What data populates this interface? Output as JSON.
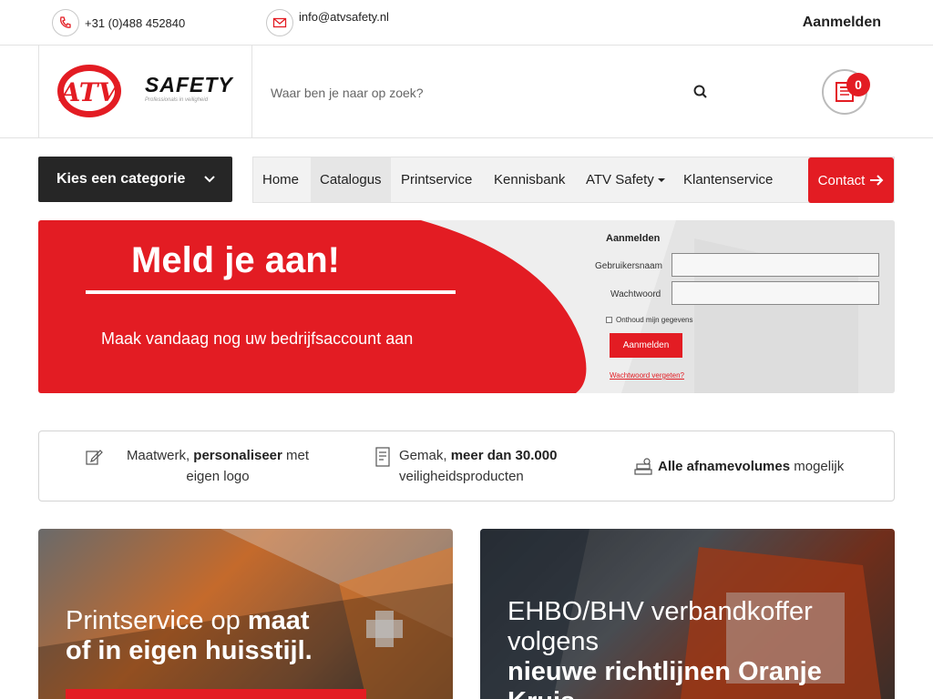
{
  "topbar": {
    "phone": "+31 (0)488 452840",
    "email": "info@atvsafety.nl",
    "login": "Aanmelden"
  },
  "header": {
    "logo_text": "SAFETY",
    "logo_tagline": "Professionals in veiligheid",
    "search_placeholder": "Waar ben je naar op zoek?",
    "cart_count": "0"
  },
  "nav": {
    "category_button": "Kies een categorie",
    "items": [
      "Home",
      "Catalogus",
      "Printservice",
      "Kennisbank",
      "ATV Safety",
      "Klantenservice"
    ],
    "contact": "Contact"
  },
  "hero": {
    "title": "Meld je aan!",
    "subtitle": "Maak vandaag nog uw bedrijfsaccount aan",
    "login_title": "Aanmelden",
    "username_label": "Gebruikersnaam",
    "password_label": "Wachtwoord",
    "remember": "Onthoud mijn gegevens",
    "button": "Aanmelden",
    "forgot": "Wachtwoord vergeten?"
  },
  "usp": {
    "item1_a": "Maatwerk, ",
    "item1_b": "personaliseer",
    "item1_c": " met",
    "item1_d": "eigen logo",
    "item2_a": "Gemak, ",
    "item2_b": "meer dan 30.000",
    "item2_c": "veiligheidsproducten",
    "item3_b": "Alle afnamevolumes",
    "item3_c": " mogelijk"
  },
  "cards": {
    "card1_a": "Printservice op ",
    "card1_b": "maat",
    "card1_c": "of in eigen huisstijl.",
    "card2_a": "EHBO/BHV verbandkoffer",
    "card2_b": "volgens",
    "card2_c": "nieuwe richtlijnen Oranje",
    "card2_d": "Kruis"
  },
  "colors": {
    "accent": "#e31c23",
    "dark": "#262626"
  }
}
